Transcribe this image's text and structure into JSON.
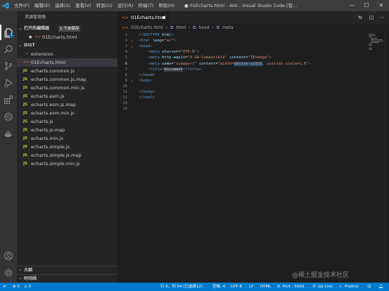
{
  "titlebar": {
    "menu": [
      "文件(F)",
      "编辑(E)",
      "选择(S)",
      "查看(V)",
      "转到(G)",
      "运行(R)",
      "终端(T)",
      "帮助(H)"
    ],
    "title": "● 01Echarts.html - dist - Visual Studio Code [管..."
  },
  "activity": {
    "icons": [
      "explorer-icon",
      "search-icon",
      "source-control-icon",
      "run-debug-icon",
      "extensions-icon",
      "remote-explorer-icon",
      "docker-icon",
      "account-icon",
      "settings-icon"
    ],
    "badge": "1"
  },
  "sidebar": {
    "title": "资源管理器",
    "open_editors_label": "打开的编辑器",
    "unsaved_badge": "1 个未保存",
    "open_file": "01Echarts.html",
    "folder": "DIST",
    "items": [
      {
        "label": "extension",
        "kind": "folder"
      },
      {
        "label": "01Echarts.html",
        "kind": "html",
        "selected": true
      },
      {
        "label": "echarts.common.js",
        "kind": "js"
      },
      {
        "label": "echarts.common.js.map",
        "kind": "js"
      },
      {
        "label": "echarts.common.min.js",
        "kind": "js"
      },
      {
        "label": "echarts.esm.js",
        "kind": "js"
      },
      {
        "label": "echarts.esm.js.map",
        "kind": "js"
      },
      {
        "label": "echarts.esm.min.js",
        "kind": "js"
      },
      {
        "label": "echarts.js",
        "kind": "js"
      },
      {
        "label": "echarts.js.map",
        "kind": "js"
      },
      {
        "label": "echarts.min.js",
        "kind": "js"
      },
      {
        "label": "echarts.simple.js",
        "kind": "js"
      },
      {
        "label": "echarts.simple.js.map",
        "kind": "js"
      },
      {
        "label": "echarts.simple.min.js",
        "kind": "js"
      }
    ],
    "outline_label": "大纲",
    "timeline_label": "时间线"
  },
  "editor": {
    "tab_label": "01Echarts.html",
    "breadcrumb": [
      "01Echarts.html",
      "html",
      "head",
      "meta"
    ],
    "line_numbers": [
      "1",
      "2",
      "3",
      "4",
      "5",
      "6",
      "7",
      "8",
      "9",
      "10",
      "11",
      "12",
      "13",
      "14"
    ]
  },
  "statusbar": {
    "errors": "⊗ 0",
    "warnings": "⚠ 0",
    "position": "行 6，列 54 (已选择12)",
    "spaces": "空格: 4",
    "encoding": "UTF-8",
    "eol": "LF",
    "language": "HTML",
    "port": "Port : 5500",
    "golive": "Go Live",
    "prettier": "Prettier"
  },
  "watermark": "@稀土掘金技术社区"
}
